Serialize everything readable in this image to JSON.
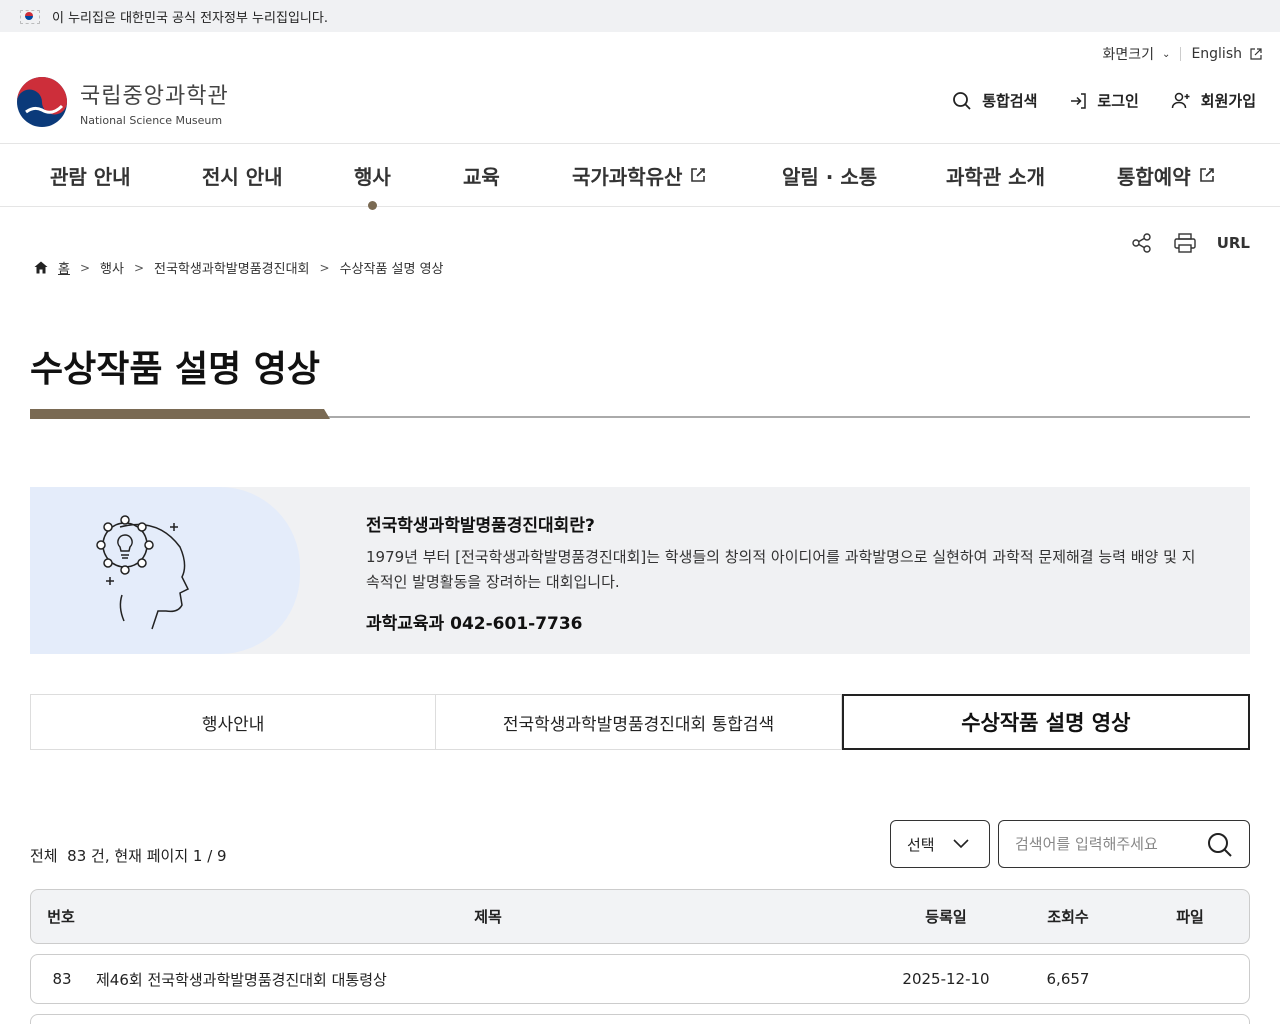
{
  "gov_banner": {
    "text": "이 누리집은 대한민국 공식 전자정부 누리집입니다."
  },
  "utility": {
    "screen_size": "화면크기",
    "language": "English"
  },
  "logo": {
    "name_ko": "국립중앙과학관",
    "name_en": "National Science Museum"
  },
  "header_actions": {
    "search": "통합검색",
    "login": "로그인",
    "signup": "회원가입"
  },
  "nav": {
    "items": [
      {
        "label": "관람 안내"
      },
      {
        "label": "전시 안내"
      },
      {
        "label": "행사",
        "active": true
      },
      {
        "label": "교육"
      },
      {
        "label": "국가과학유산",
        "external": true
      },
      {
        "label": "알림 · 소통"
      },
      {
        "label": "과학관 소개"
      },
      {
        "label": "통합예약",
        "external": true
      }
    ]
  },
  "page_tools": {
    "url_label": "URL"
  },
  "breadcrumb": {
    "home": "홈",
    "level1": "행사",
    "level2": "전국학생과학발명품경진대회",
    "current": "수상작품 설명 영상"
  },
  "page_title": "수상작품 설명 영상",
  "intro": {
    "heading": "전국학생과학발명품경진대회란?",
    "description": "1979년 부터 [전국학생과학발명품경진대회]는 학생들의 창의적 아이디어를 과학발명으로 실현하여 과학적 문제해결 능력 배양 및 지속적인 발명활동을 장려하는 대회입니다.",
    "contact": "과학교육과 042-601-7736"
  },
  "tabs": [
    {
      "label": "행사안내"
    },
    {
      "label": "전국학생과학발명품경진대회 통합검색"
    },
    {
      "label": "수상작품 설명 영상",
      "active": true
    }
  ],
  "list_info": {
    "prefix": "전체",
    "total": "83",
    "middle": "건, 현재 페이지",
    "page": "1 / 9"
  },
  "search": {
    "select_label": "선택",
    "placeholder": "검색어를 입력해주세요"
  },
  "table": {
    "headers": {
      "no": "번호",
      "title": "제목",
      "date": "등록일",
      "views": "조회수",
      "file": "파일"
    },
    "rows": [
      {
        "no": "83",
        "title": "제46회 전국학생과학발명품경진대회 대통령상",
        "date": "2025-12-10",
        "views": "6,657",
        "file": ""
      }
    ]
  },
  "colors": {
    "accent": "#7a6a53",
    "banner_bg": "#f0f1f3",
    "intro_img_bg": "#e4ecfa"
  }
}
